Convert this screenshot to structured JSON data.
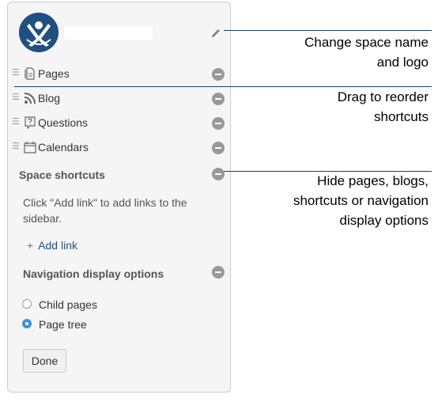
{
  "header": {
    "logo_icon": "confluence-space-logo-icon",
    "edit_icon": "pencil-icon"
  },
  "sidebar": {
    "items": [
      {
        "label": "Pages",
        "icon": "pages-icon"
      },
      {
        "label": "Blog",
        "icon": "rss-icon"
      },
      {
        "label": "Questions",
        "icon": "question-icon"
      },
      {
        "label": "Calendars",
        "icon": "calendar-icon"
      }
    ]
  },
  "space_shortcuts": {
    "title": "Space shortcuts",
    "help_text": "Click \"Add link\" to add links to the sidebar.",
    "add_link_label": "Add link"
  },
  "navigation": {
    "title": "Navigation display options",
    "options": [
      {
        "label": "Child pages",
        "selected": false
      },
      {
        "label": "Page tree",
        "selected": true
      }
    ]
  },
  "done_label": "Done",
  "callouts": [
    {
      "text_line1": "Change space name",
      "text_line2": "and logo"
    },
    {
      "text_line1": "Drag to reorder",
      "text_line2": "shortcuts"
    },
    {
      "text_line1": "Hide pages, blogs,",
      "text_line2": "shortcuts or navigation",
      "text_line3": "display options"
    }
  ],
  "colors": {
    "logo_bg": "#205081",
    "link": "#205081",
    "radio_checked": "#3b8fe3",
    "callout_line": "#1e3f73"
  }
}
